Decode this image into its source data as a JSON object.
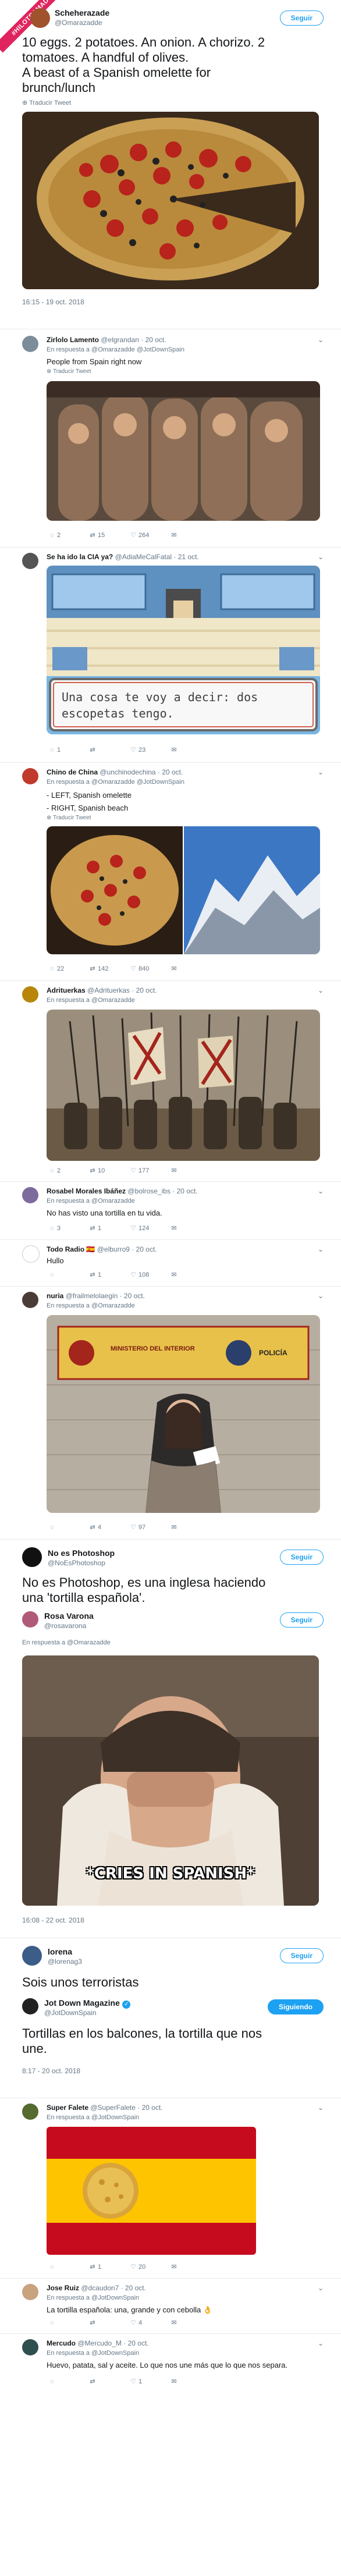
{
  "colors": {
    "accent": "#1da1f2",
    "red": "#e0245e",
    "border": "#e6ecf0",
    "muted": "#657786"
  },
  "badge": {
    "label": "#HILOTRAMADO"
  },
  "t1": {
    "name": "Scheherazade",
    "handle": "@Omarazadde",
    "follow": "Seguir",
    "lines": [
      "10 eggs. 2 potatoes. An onion. A chorizo. 2",
      "tomatoes. A handful of olives.",
      "A beast of a Spanish omelette for",
      "brunch/lunch"
    ],
    "translate": "Traducir Tweet",
    "time": "16:15 - 19 oct. 2018"
  },
  "t2": {
    "name": "Zirlolo Lamento",
    "handle": "@elgrandan · 20 oct.",
    "reply": "En respuesta a @Omarazadde @JotDownSpain",
    "text": "People from Spain right now",
    "translate": "Traducir Tweet",
    "stats": [
      "2",
      "15",
      "264"
    ]
  },
  "t3": {
    "name": "Se ha ido la CIA ya?",
    "handle": "@AdiaMeCalFatal · 21 oct.",
    "dialog": "Una cosa te voy a decir: dos escopetas tengo.",
    "stats": [
      "1",
      "",
      "23"
    ]
  },
  "t4": {
    "name": "Chino de China",
    "handle": "@unchinodechina · 20 oct.",
    "reply": "En respuesta a @Omarazadde @JotDownSpain",
    "lines": [
      "- LEFT, Spanish omelette",
      "- RIGHT, Spanish beach"
    ],
    "translate": "Traducir Tweet",
    "stats": [
      "22",
      "142",
      "840"
    ]
  },
  "t5": {
    "name": "Adrituerkas",
    "handle": "@Adrituerkas · 20 oct.",
    "reply": "En respuesta a @Omarazadde",
    "stats": [
      "2",
      "10",
      "177"
    ]
  },
  "t6": {
    "name": "Rosabel Morales Ibáñez",
    "handle": "@bolrose_ibs · 20 oct.",
    "reply": "En respuesta a @Omarazadde",
    "text": "No has visto una tortilla en tu vida.",
    "stats": [
      "3",
      "1",
      "124"
    ]
  },
  "t7": {
    "name": "Todo Radio 🇪🇸",
    "handle": "@elburro9 · 20 oct.",
    "text": "Hullo",
    "stats": [
      "",
      "1",
      "108"
    ]
  },
  "t8": {
    "name": "nuria",
    "handle": "@frailmelolaegin · 20 oct.",
    "reply": "En respuesta a @Omarazadde",
    "sign1": "MINISTERIO DEL INTERIOR",
    "sign2": "POLICÍA",
    "stats": [
      "",
      "4",
      "97"
    ]
  },
  "t9": {
    "name": "No es Photoshop",
    "handle": "@NoEsPhotoshop",
    "follow": "Seguir",
    "lines": [
      "No es Photoshop, es una inglesa haciendo",
      "una 'tortilla española'."
    ],
    "inner_name": "Rosa Varona",
    "inner_handle": "@rosavarona",
    "inner_follow": "Seguir",
    "inner_reply": "En respuesta a @Omarazadde",
    "caption": "*CRIES IN SPANISH*",
    "time": "16:08 - 22 oct. 2018"
  },
  "t10": {
    "name": "lorena",
    "handle": "@lorenag3",
    "follow": "Seguir",
    "text": "Sois unos terroristas",
    "inner_name": "Jot Down Magazine",
    "inner_handle": "@JotDownSpain",
    "inner_follow": "Siguiendo",
    "lines": [
      "Tortillas en los balcones, la tortilla que nos",
      "une."
    ],
    "time": "8:17 - 20 oct. 2018"
  },
  "t11": {
    "name": "Super Falete",
    "handle": "@SuperFalete · 20 oct.",
    "reply": "En respuesta a @JotDownSpain",
    "stats": [
      "",
      "1",
      "20"
    ]
  },
  "t12": {
    "name": "Jose Ruiz",
    "handle": "@dcaudon7 · 20 oct.",
    "reply": "En respuesta a @JotDownSpain",
    "text": "La tortilla española: una, grande y con cebolla 👌",
    "stats": [
      "",
      "",
      "4"
    ]
  },
  "t13": {
    "name": "Mercudo",
    "handle": "@Mercudo_M · 20 oct.",
    "reply": "En respuesta a @JotDownSpain",
    "text": "Huevo, patata, sal y aceite. Lo que nos une más que lo que nos separa.",
    "stats": [
      "",
      "",
      "1"
    ]
  }
}
